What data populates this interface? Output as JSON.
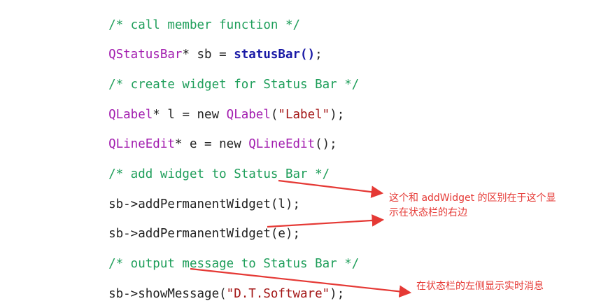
{
  "colors": {
    "comment": "#1e9e5a",
    "type": "#a21caf",
    "function": "#1a1aa6",
    "string": "#a31515",
    "plain": "#222222",
    "annotation": "#e53935"
  },
  "code": {
    "line1": {
      "comment": "/* call member function */"
    },
    "line2": {
      "type": "QStatusBar",
      "middle": "* sb = ",
      "func": "statusBar",
      "parens": "()",
      "end": ";"
    },
    "line3": {
      "comment": "/* create widget for Status Bar */"
    },
    "line4": {
      "type": "QLabel",
      "middle": "* l = new ",
      "type2": "QLabel",
      "open": "(",
      "string": "\"Label\"",
      "close": ");"
    },
    "line5": {
      "type": "QLineEdit",
      "middle": "* e = new ",
      "type2": "QLineEdit",
      "rest": "();"
    },
    "line6": {
      "comment": "/* add widget to Status Bar */"
    },
    "line7": {
      "text": "sb->addPermanentWidget(l);"
    },
    "line8": {
      "text": "sb->addPermanentWidget(e);"
    },
    "line9": {
      "comment": "/* output message to Status Bar */"
    },
    "line10": {
      "prefix": "sb->showMessage(",
      "string": "\"D.T.Software\"",
      "suffix": ");"
    }
  },
  "annotations": {
    "permanent_line1": "这个和 addWidget 的区别在于这个显",
    "permanent_line2": "示在状态栏的右边",
    "message": "在状态栏的左侧显示实时消息"
  }
}
